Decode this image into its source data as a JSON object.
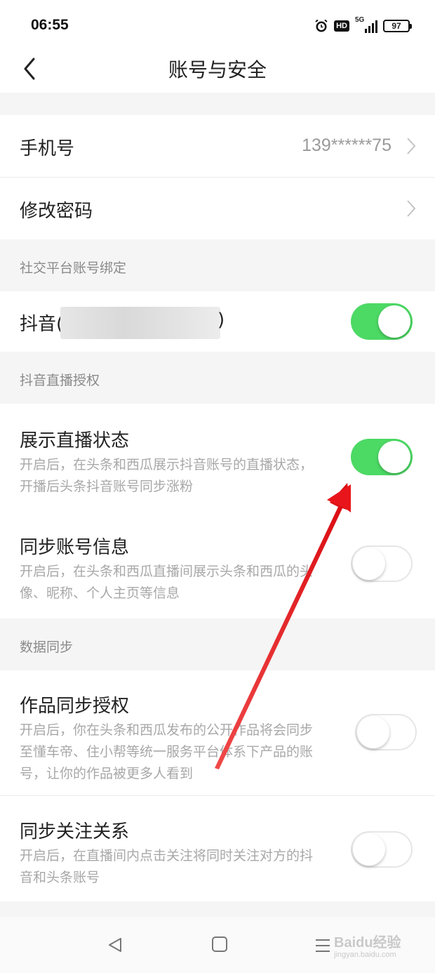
{
  "status_bar": {
    "time": "06:55",
    "hd": "HD",
    "network": "5G",
    "battery": "97"
  },
  "header": {
    "title": "账号与安全"
  },
  "account": {
    "phone_label": "手机号",
    "phone_value": "139******75",
    "password_label": "修改密码"
  },
  "social": {
    "section": "社交平台账号绑定",
    "douyin_label": "抖音(",
    "douyin_close": ")",
    "douyin_enabled": true
  },
  "live_auth": {
    "section": "抖音直播授权",
    "items": [
      {
        "title": "展示直播状态",
        "desc": "开启后，在头条和西瓜展示抖音账号的直播状态，开播后头条抖音账号同步涨粉",
        "enabled": true
      },
      {
        "title": "同步账号信息",
        "desc": "开启后，在头条和西瓜直播间展示头条和西瓜的头像、昵称、个人主页等信息",
        "enabled": false
      }
    ]
  },
  "data_sync": {
    "section": "数据同步",
    "items": [
      {
        "title": "作品同步授权",
        "desc": "开启后，你在头条和西瓜发布的公开作品将会同步至懂车帝、住小帮等统一服务平台体系下产品的账号，让你的作品被更多人看到",
        "enabled": false
      },
      {
        "title": "同步关注关系",
        "desc": "开启后，在直播间内点击关注将同时关注对方的抖音和头条账号",
        "enabled": false
      }
    ]
  },
  "watermark": {
    "brand": "Baidu经验",
    "url": "jingyan.baidu.com"
  },
  "colors": {
    "toggle_on": "#4cd964",
    "background_gap": "#f5f5f5",
    "annotation_arrow": "#e8161b"
  },
  "icons": [
    "back-icon",
    "chevron-right-icon",
    "alarm-icon",
    "signal-icon",
    "battery-icon",
    "nav-back-icon",
    "nav-home-icon",
    "nav-menu-icon"
  ]
}
